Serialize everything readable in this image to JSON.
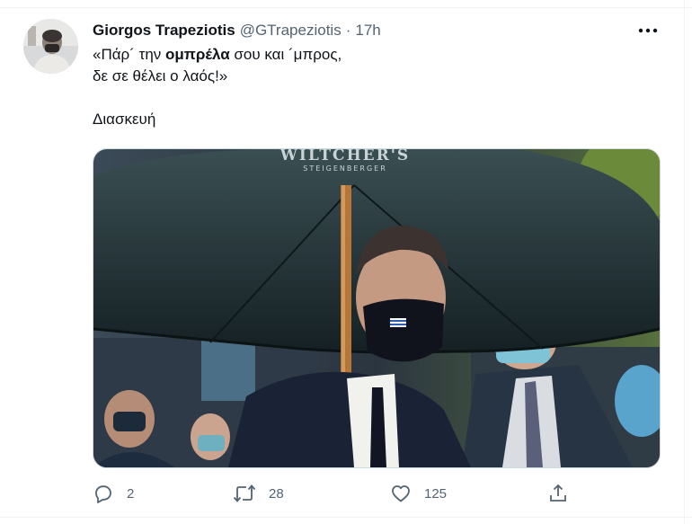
{
  "tweet": {
    "author_name": "Giorgos Trapeziotis",
    "author_handle": "@GTrapeziotis",
    "separator": "·",
    "time": "17h",
    "text_line1_a": "«Πάρ´ την ",
    "text_line1_bold": "ομπρέλα",
    "text_line1_b": " σου και ´μπρος,",
    "text_line2": "δε σε θέλει ο λαός!»",
    "text_line3": "Διασκευή"
  },
  "media": {
    "umbrella_brand": "WILTCHER'S",
    "umbrella_subbrand": "STEIGENBERGER"
  },
  "actions": {
    "reply_count": "2",
    "retweet_count": "28",
    "like_count": "125"
  },
  "icons": {
    "more": "more-horizontal-icon",
    "reply": "reply-icon",
    "retweet": "retweet-icon",
    "like": "heart-icon",
    "share": "share-icon"
  },
  "colors": {
    "text_primary": "#0f1419",
    "text_secondary": "#536471",
    "border": "#cfd9de"
  }
}
